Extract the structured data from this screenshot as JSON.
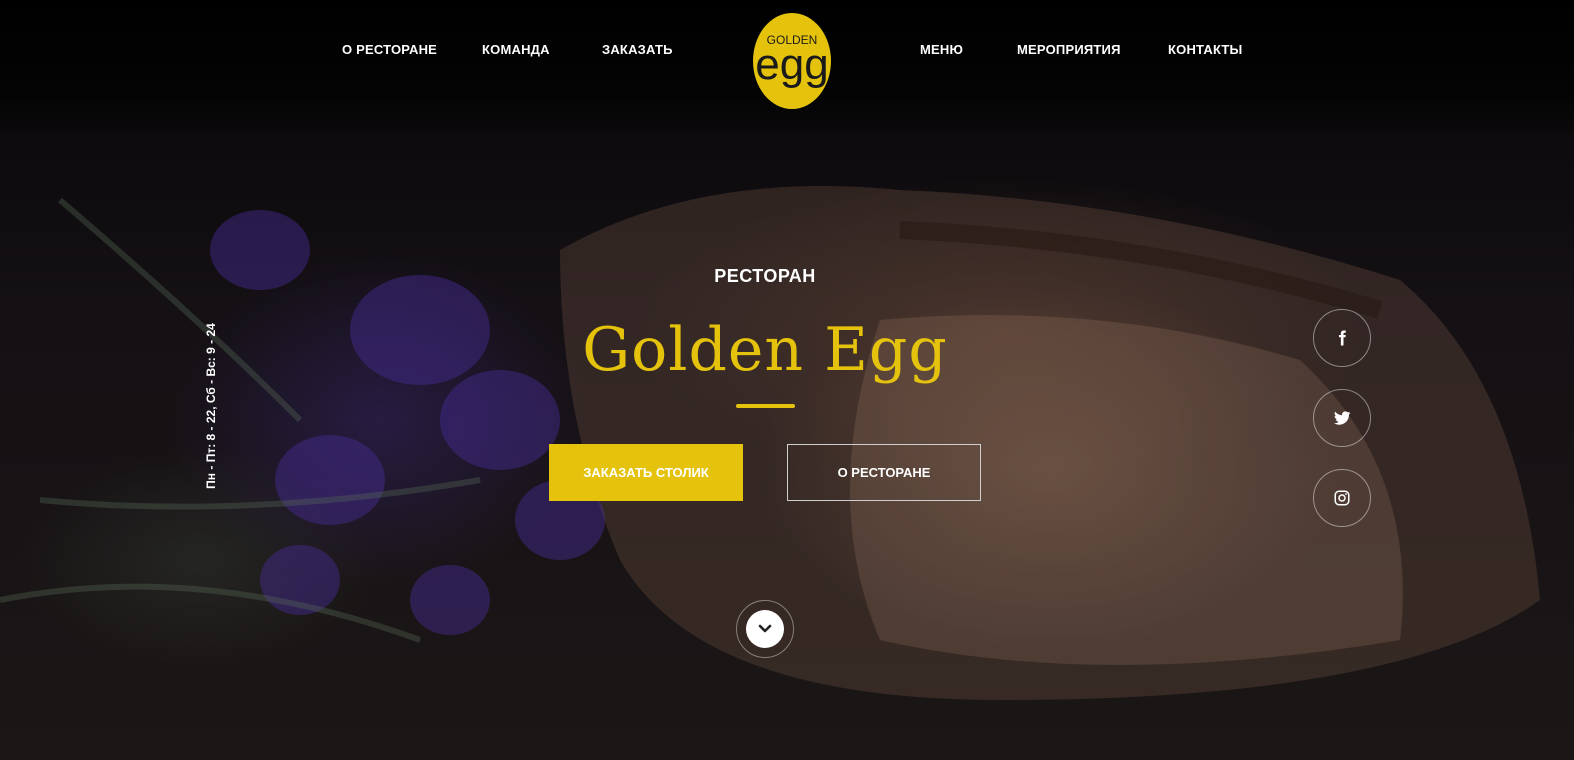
{
  "nav": {
    "left": [
      "О РЕСТОРАНЕ",
      "КОМАНДА",
      "ЗАКАЗАТЬ"
    ],
    "right": [
      "МЕНЮ",
      "МЕРОПРИЯТИЯ",
      "КОНТАКТЫ"
    ]
  },
  "logo": {
    "small_text": "GOLDEN",
    "big_text": "egg"
  },
  "hours": "Пн - Пт: 8 - 22, Сб - Вс: 9 - 24",
  "hero": {
    "subtitle": "РЕСТОРАН",
    "title": "Golden Egg",
    "primary_button": "ЗАКАЗАТЬ СТОЛИК",
    "secondary_button": "О РЕСТОРАНЕ"
  },
  "social": [
    "facebook-icon",
    "twitter-icon",
    "instagram-icon"
  ],
  "colors": {
    "accent": "#e5c30d",
    "background": "#0c0a0c"
  }
}
